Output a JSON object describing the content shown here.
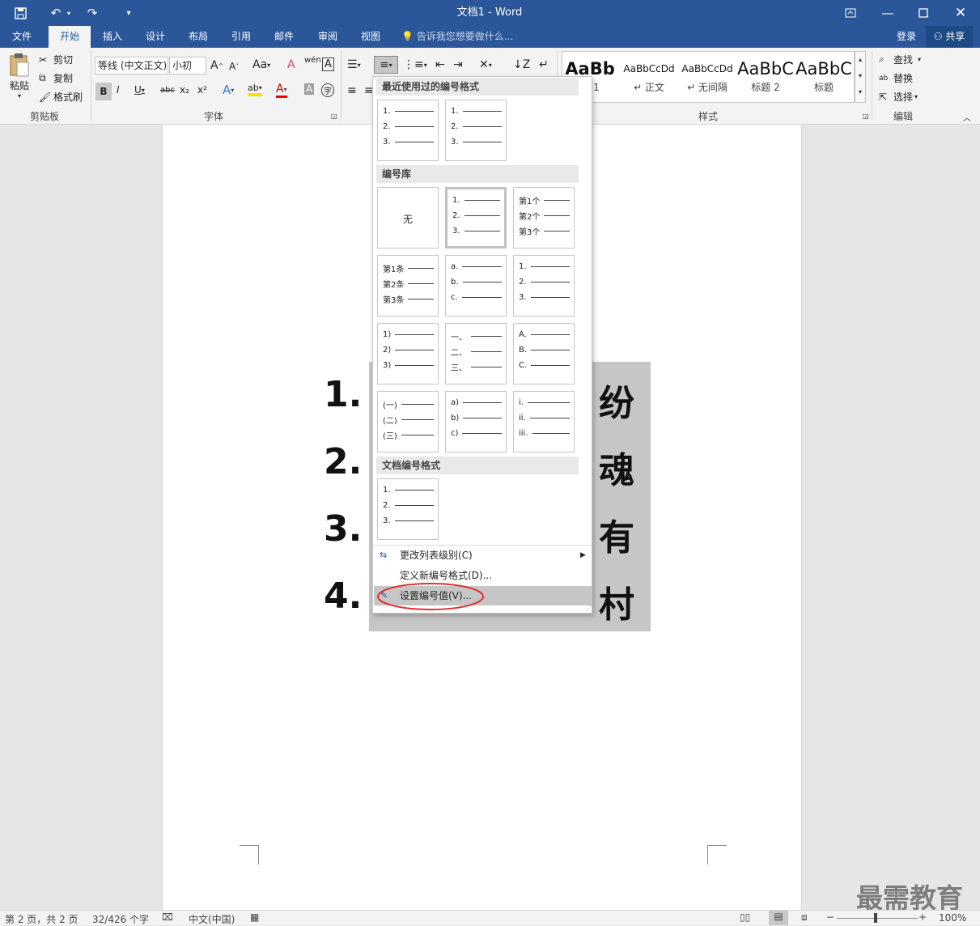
{
  "title_bar": {
    "document_title": "文档1 - Word"
  },
  "tabs": [
    {
      "label": "文件"
    },
    {
      "label": "开始"
    },
    {
      "label": "插入"
    },
    {
      "label": "设计"
    },
    {
      "label": "布局"
    },
    {
      "label": "引用"
    },
    {
      "label": "邮件"
    },
    {
      "label": "审阅"
    },
    {
      "label": "视图"
    }
  ],
  "tell_me": "告诉我您想要做什么...",
  "account": {
    "login": "登录",
    "share": "共享"
  },
  "clipboard": {
    "paste": "粘贴",
    "cut": "剪切",
    "copy": "复制",
    "format_painter": "格式刷",
    "label": "剪贴板"
  },
  "font": {
    "name": "等线 (中文正文)",
    "size": "小初",
    "label": "字体",
    "case": "Aa",
    "clear": "A",
    "pinyin": "wén",
    "border_char": "A",
    "bold": "B",
    "italic": "I",
    "underline": "U",
    "strike": "abc",
    "sub": "x₂",
    "sup": "x²",
    "effect": "A",
    "highlight": "ab",
    "color": "A",
    "shade": "A",
    "enclose": "字"
  },
  "styles": {
    "items": [
      {
        "preview": "AaBb",
        "name": "题 1"
      },
      {
        "preview": "AaBbCcDd",
        "name": "↵ 正文"
      },
      {
        "preview": "AaBbCcDd",
        "name": "↵ 无间隔"
      },
      {
        "preview": "AaBbC",
        "name": "标题 2"
      },
      {
        "preview": "AaBbC",
        "name": "标题"
      }
    ],
    "label": "样式"
  },
  "editing": {
    "find": "查找",
    "replace": "替换",
    "select": "选择",
    "label": "编辑"
  },
  "numbering_menu": {
    "recent_header": "最近使用过的编号格式",
    "recent": [
      {
        "rows": [
          "1.",
          "2.",
          "3."
        ]
      },
      {
        "rows": [
          "1.",
          "2.",
          "3."
        ]
      }
    ],
    "library_header": "编号库",
    "library": [
      {
        "none": "无"
      },
      {
        "rows": [
          "1.",
          "2.",
          "3."
        ]
      },
      {
        "rows": [
          "第1个",
          "第2个",
          "第3个"
        ]
      },
      {
        "rows": [
          "第1条",
          "第2条",
          "第3条"
        ]
      },
      {
        "rows": [
          "a.",
          "b.",
          "c."
        ]
      },
      {
        "rows": [
          "1.",
          "2.",
          "3."
        ]
      },
      {
        "rows": [
          "1)",
          "2)",
          "3)"
        ]
      },
      {
        "rows": [
          "一、",
          "二、",
          "三、"
        ]
      },
      {
        "rows": [
          "A.",
          "B.",
          "C."
        ]
      },
      {
        "rows": [
          "(一)",
          "(二)",
          "(三)"
        ]
      },
      {
        "rows": [
          "a)",
          "b)",
          "c)"
        ]
      },
      {
        "rows": [
          "i.",
          "ii.",
          "iii."
        ]
      }
    ],
    "document_header": "文档编号格式",
    "document": [
      {
        "rows": [
          "1.",
          "2.",
          "3."
        ]
      }
    ],
    "change_level": "更改列表级别(C)",
    "define_new": "定义新编号格式(D)...",
    "set_value": "设置编号值(V)..."
  },
  "document_list": {
    "numbers": [
      "1.",
      "2.",
      "3.",
      "4."
    ],
    "visible_tail": [
      "纷",
      "魂",
      "有",
      "村"
    ]
  },
  "status_bar": {
    "page": "第 2 页，共 2 页",
    "words": "32/426 个字",
    "language": "中文(中国)",
    "zoom": "100%"
  },
  "watermark": "最需教育"
}
